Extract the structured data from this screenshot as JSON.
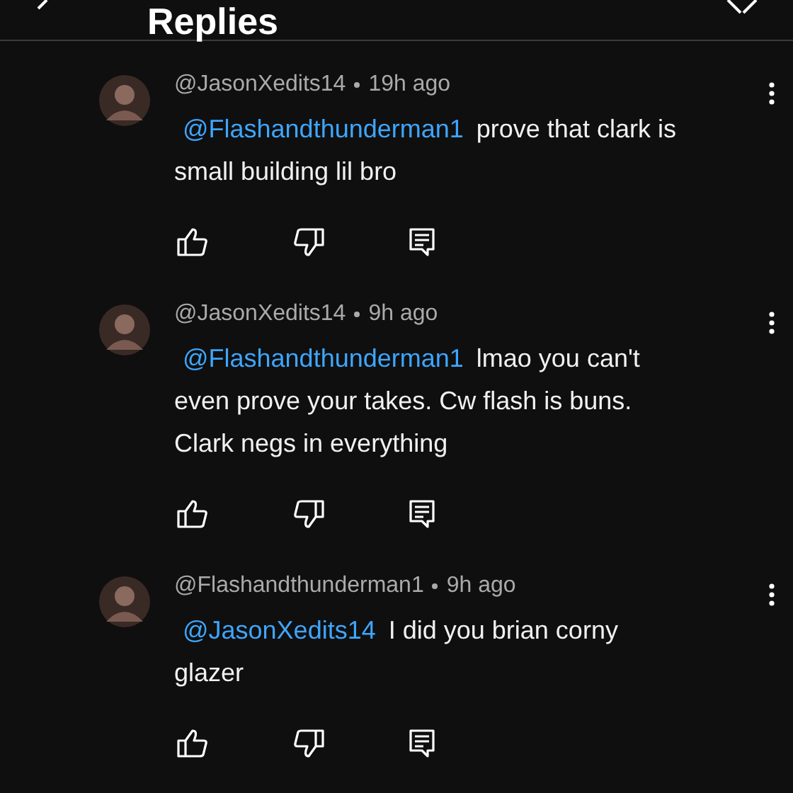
{
  "header": {
    "title": "Replies"
  },
  "comments": [
    {
      "author": "@JasonXedits14",
      "time": "19h ago",
      "mention": "@Flashandthunderman1",
      "text": "prove that clark is small building lil bro"
    },
    {
      "author": "@JasonXedits14",
      "time": "9h ago",
      "mention": "@Flashandthunderman1",
      "text": "lmao you can't even prove your takes. Cw flash is buns. Clark negs in everything"
    },
    {
      "author": "@Flashandthunderman1",
      "time": "9h ago",
      "mention": "@JasonXedits14",
      "text": "I did you brian corny glazer"
    }
  ]
}
